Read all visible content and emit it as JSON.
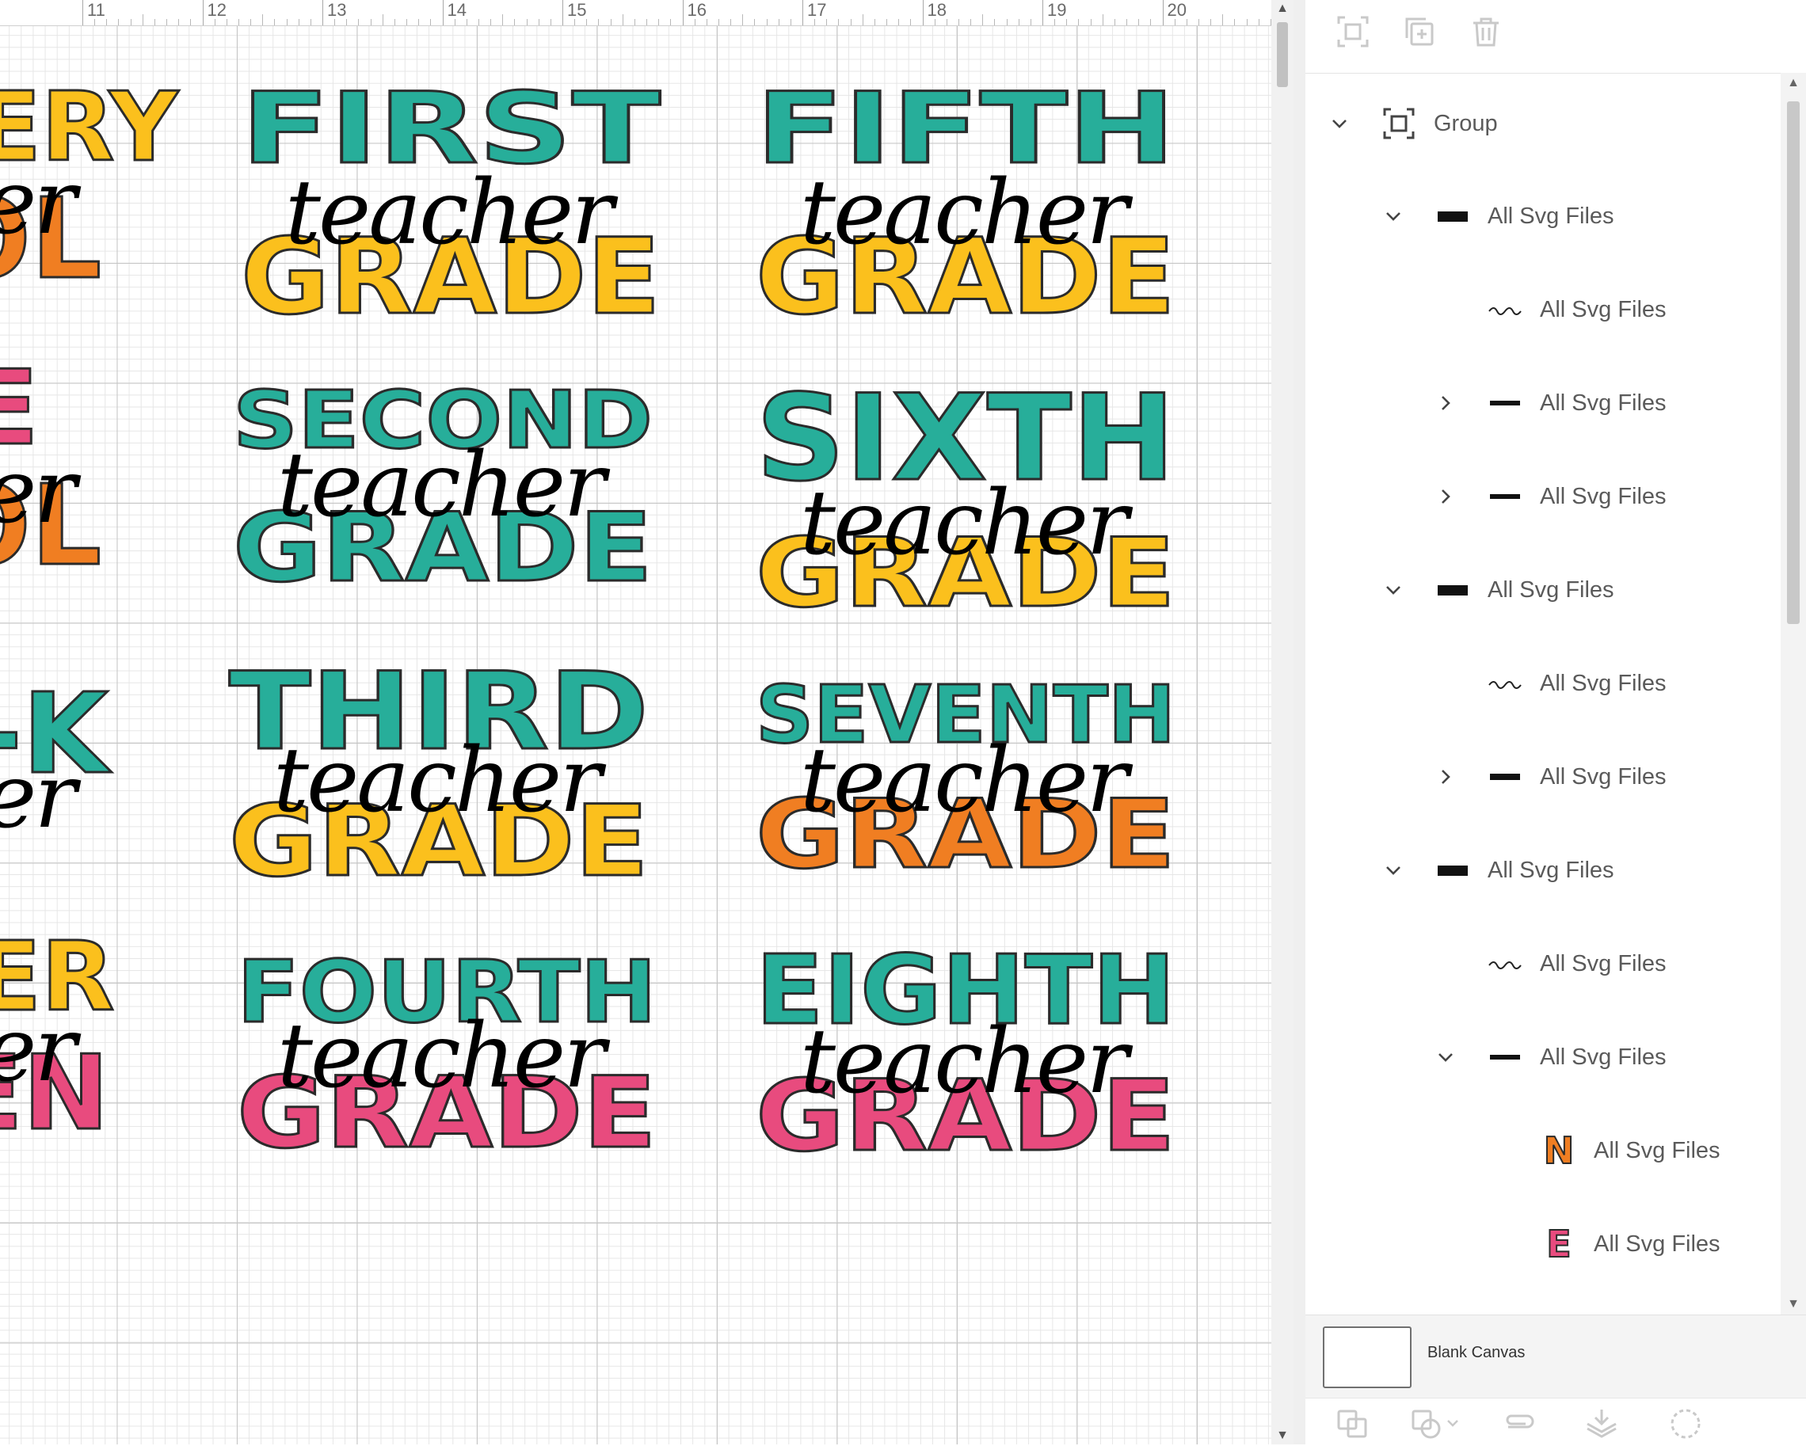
{
  "ruler": {
    "marks": [
      "11",
      "12",
      "13",
      "14",
      "15",
      "16",
      "17",
      "18",
      "19",
      "20"
    ]
  },
  "colors": {
    "teal": "#27ae9a",
    "pink": "#e84b7e",
    "yellow": "#fbc01d",
    "orange": "#f07e22",
    "outline": "#2b2b2b"
  },
  "designs": {
    "left_column": {
      "row1_top": "ERY",
      "row1_script": "er",
      "row1_bottom": "OL",
      "row2_top": "E",
      "row2_script": "er",
      "row2_bottom": "OL",
      "row3_top": "-K",
      "row3_script": "er",
      "row4_top": "ER",
      "row4_script": "er",
      "row4_bottom": "EN"
    },
    "first": {
      "top": "FIRST",
      "script": "teacher",
      "bottom": "GRADE"
    },
    "fifth": {
      "top": "FIFTH",
      "script": "teacher",
      "bottom": "GRADE"
    },
    "second": {
      "top": "SECOND",
      "script": "teacher",
      "bottom": "GRADE"
    },
    "sixth": {
      "top": "SIXTH",
      "script": "teacher",
      "bottom": "GRADE"
    },
    "third": {
      "top": "THIRD",
      "script": "teacher",
      "bottom": "GRADE"
    },
    "seventh": {
      "top": "SEVENTH",
      "script": "teacher",
      "bottom": "GRADE"
    },
    "fourth": {
      "top": "FOURTH",
      "script": "teacher",
      "bottom": "GRADE"
    },
    "eighth": {
      "top": "EIGHTH",
      "script": "teacher",
      "bottom": "GRADE"
    }
  },
  "layers": {
    "group": {
      "label": "Group",
      "expanded": true
    },
    "items": [
      {
        "label": "All Svg Files",
        "chevron": "down",
        "thumb": "block"
      },
      {
        "label": "All Svg Files",
        "chevron": "none",
        "thumb": "script"
      },
      {
        "label": "All Svg Files",
        "chevron": "right",
        "thumb": "line"
      },
      {
        "label": "All Svg Files",
        "chevron": "right",
        "thumb": "line"
      },
      {
        "label": "All Svg Files",
        "chevron": "down",
        "thumb": "block"
      },
      {
        "label": "All Svg Files",
        "chevron": "none",
        "thumb": "script"
      },
      {
        "label": "All Svg Files",
        "chevron": "right",
        "thumb": "line"
      },
      {
        "label": "All Svg Files",
        "chevron": "down",
        "thumb": "block"
      },
      {
        "label": "All Svg Files",
        "chevron": "none",
        "thumb": "script"
      },
      {
        "label": "All Svg Files",
        "chevron": "down",
        "thumb": "line"
      },
      {
        "label": "All Svg Files",
        "chevron": "none",
        "thumb": "letter-N"
      },
      {
        "label": "All Svg Files",
        "chevron": "none",
        "thumb": "letter-E"
      }
    ],
    "thumb_letters": {
      "n": "N",
      "e": "E"
    }
  },
  "canvas": {
    "label": "Blank Canvas"
  },
  "icons": {
    "top_toolbar": [
      "group-icon",
      "duplicate-icon",
      "delete-icon"
    ],
    "bottom_toolbar": [
      "slice-icon",
      "combine-icon",
      "attach-icon",
      "flatten-icon",
      "contour-icon"
    ]
  }
}
